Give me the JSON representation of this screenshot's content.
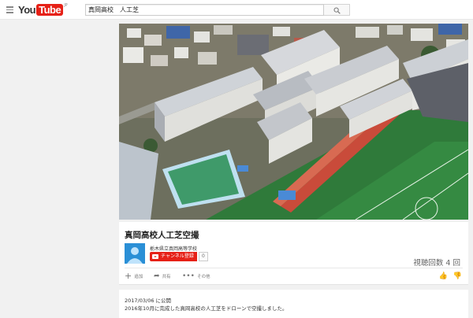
{
  "masthead": {
    "logo_you": "You",
    "logo_tube": "Tube",
    "logo_region": "JP",
    "search_value": "真岡高校　人工芝",
    "menu_icon": "hamburger-icon",
    "search_icon": "magnifier-icon"
  },
  "video": {
    "title": "真岡高校人工芝空撮",
    "channel_name": "栃木県立真岡高等学校",
    "subscribe_label": "チャンネル登録",
    "subscriber_count": "0",
    "view_count": "視聴回数 4 回",
    "actions": [
      {
        "label": "追加",
        "icon": "plus-icon"
      },
      {
        "label": "共有",
        "icon": "share-icon"
      },
      {
        "label": "その他",
        "icon": "more-icon"
      }
    ],
    "like_icon": "thumbs-up-icon",
    "dislike_icon": "thumbs-down-icon"
  },
  "description": {
    "published": "2017/03/06 に公開",
    "text": "2016年10月に完成した真岡高校の人工芝をドローンで空撮しました。"
  },
  "colors": {
    "brand_red": "#e62117",
    "page_bg": "#f1f1f1"
  }
}
